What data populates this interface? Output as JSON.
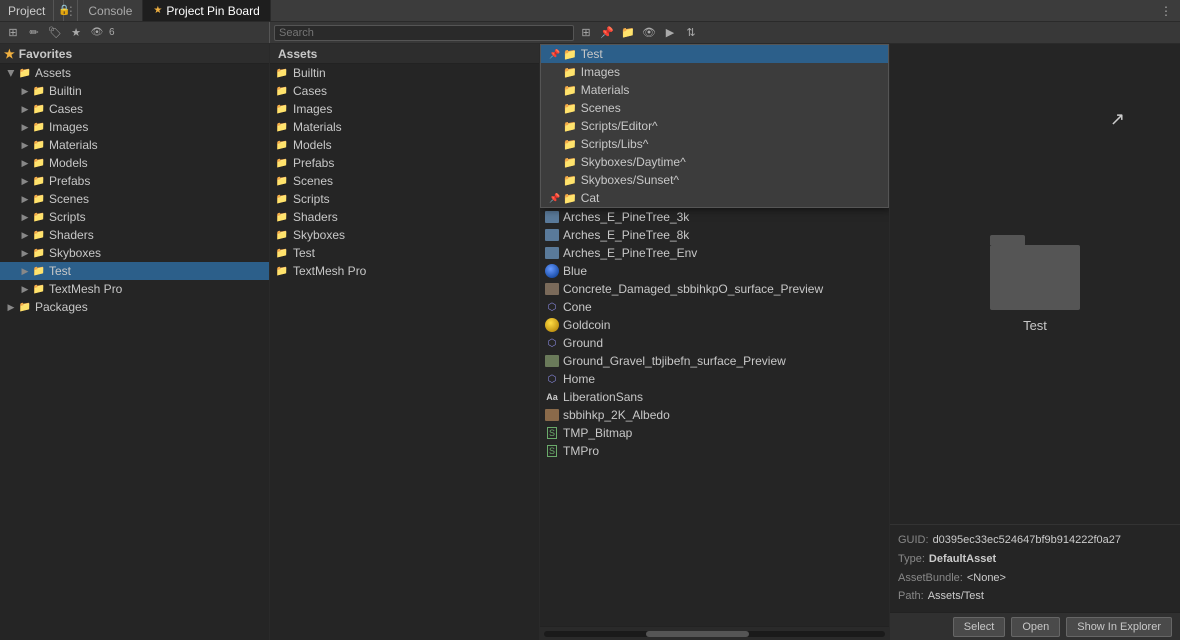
{
  "topbar": {
    "project_label": "Project",
    "lock_icon": "🔒",
    "menu_icon": "⋮",
    "tabs": [
      {
        "label": "Console",
        "star": false,
        "active": false
      },
      {
        "label": "Project Pin Board",
        "star": true,
        "active": true
      }
    ]
  },
  "toolbar": {
    "icons": [
      "⊞",
      "✏",
      "🏷",
      "★",
      "👁 6"
    ],
    "search_placeholder": "Search"
  },
  "left_panel": {
    "favorites_header": "Favorites",
    "assets_header": "Assets",
    "favorites_items": [],
    "assets_items": [
      {
        "label": "Assets",
        "level": 0,
        "expanded": true,
        "is_folder": true
      },
      {
        "label": "Builtin",
        "level": 1,
        "expanded": false,
        "is_folder": true
      },
      {
        "label": "Cases",
        "level": 1,
        "expanded": false,
        "is_folder": true
      },
      {
        "label": "Images",
        "level": 1,
        "expanded": false,
        "is_folder": true
      },
      {
        "label": "Materials",
        "level": 1,
        "expanded": false,
        "is_folder": true
      },
      {
        "label": "Models",
        "level": 1,
        "expanded": false,
        "is_folder": true
      },
      {
        "label": "Prefabs",
        "level": 1,
        "expanded": false,
        "is_folder": true
      },
      {
        "label": "Scenes",
        "level": 1,
        "expanded": false,
        "is_folder": true
      },
      {
        "label": "Scripts",
        "level": 1,
        "expanded": false,
        "is_folder": true
      },
      {
        "label": "Shaders",
        "level": 1,
        "expanded": false,
        "is_folder": true
      },
      {
        "label": "Skyboxes",
        "level": 1,
        "expanded": false,
        "is_folder": true
      },
      {
        "label": "Test",
        "level": 1,
        "expanded": false,
        "is_folder": true,
        "selected": true
      },
      {
        "label": "TextMesh Pro",
        "level": 1,
        "expanded": false,
        "is_folder": true
      },
      {
        "label": "Packages",
        "level": 0,
        "expanded": false,
        "is_folder": true
      }
    ]
  },
  "middle_panel": {
    "header": "Assets",
    "items": [
      {
        "label": "Builtin",
        "is_folder": true
      },
      {
        "label": "Cases",
        "is_folder": true
      },
      {
        "label": "Images",
        "is_folder": true
      },
      {
        "label": "Materials",
        "is_folder": true
      },
      {
        "label": "Models",
        "is_folder": true
      },
      {
        "label": "Prefabs",
        "is_folder": true
      },
      {
        "label": "Scenes",
        "is_folder": true
      },
      {
        "label": "Scripts",
        "is_folder": true
      },
      {
        "label": "Shaders",
        "is_folder": true
      },
      {
        "label": "Skyboxes",
        "is_folder": true
      },
      {
        "label": "Test",
        "is_folder": true
      },
      {
        "label": "TextMesh Pro",
        "is_folder": true
      }
    ]
  },
  "center_panel": {
    "dropdown": {
      "visible": true,
      "items": [
        {
          "label": "Test",
          "pinned": false,
          "selected": true,
          "is_folder": true
        },
        {
          "label": "Images",
          "pinned": false,
          "selected": false,
          "is_folder": true
        },
        {
          "label": "Materials",
          "pinned": false,
          "selected": false,
          "is_folder": true
        },
        {
          "label": "Scenes",
          "pinned": false,
          "selected": false,
          "is_folder": true
        },
        {
          "label": "Scripts/Editor^",
          "pinned": false,
          "selected": false,
          "is_folder": true
        },
        {
          "label": "Scripts/Libs^",
          "pinned": false,
          "selected": false,
          "is_folder": true
        },
        {
          "label": "Skyboxes/Daytime^",
          "pinned": false,
          "selected": false,
          "is_folder": true
        },
        {
          "label": "Skyboxes/Sunset^",
          "pinned": false,
          "selected": false,
          "is_folder": true
        }
      ]
    },
    "dropdown_trigger": "Cat",
    "files": [
      {
        "label": "Arches_E_PineTree_3k",
        "icon_type": "image"
      },
      {
        "label": "Arches_E_PineTree_8k",
        "icon_type": "image"
      },
      {
        "label": "Arches_E_PineTree_Env",
        "icon_type": "image"
      },
      {
        "label": "Blue",
        "icon_type": "blue-sphere"
      },
      {
        "label": "Concrete_Damaged_sbbihkpO_surface_Preview",
        "icon_type": "image"
      },
      {
        "label": "Cone",
        "icon_type": "mesh"
      },
      {
        "label": "Goldcoin",
        "icon_type": "gold"
      },
      {
        "label": "Ground",
        "icon_type": "mesh"
      },
      {
        "label": "Ground_Gravel_tbjibefn_surface_Preview",
        "icon_type": "image"
      },
      {
        "label": "Home",
        "icon_type": "mesh"
      },
      {
        "label": "LiberationSans",
        "icon_type": "font"
      },
      {
        "label": "sbbihkp_2K_Albedo",
        "icon_type": "texture"
      },
      {
        "label": "TMP_Bitmap",
        "icon_type": "tmp"
      },
      {
        "label": "TMPro",
        "icon_type": "tmp"
      }
    ]
  },
  "right_panel": {
    "preview_label": "Test",
    "info": {
      "guid_key": "GUID:",
      "guid_val": "d0395ec33ec524647bf9b914222f0a27",
      "type_key": "Type:",
      "type_val": "DefaultAsset",
      "asset_bundle_key": "AssetBundle:",
      "asset_bundle_val": "<None>",
      "path_key": "Path:",
      "path_val": "Assets/Test"
    }
  },
  "bottom_bar": {
    "select_label": "Select",
    "open_label": "Open",
    "show_explorer_label": "Show In Explorer"
  }
}
